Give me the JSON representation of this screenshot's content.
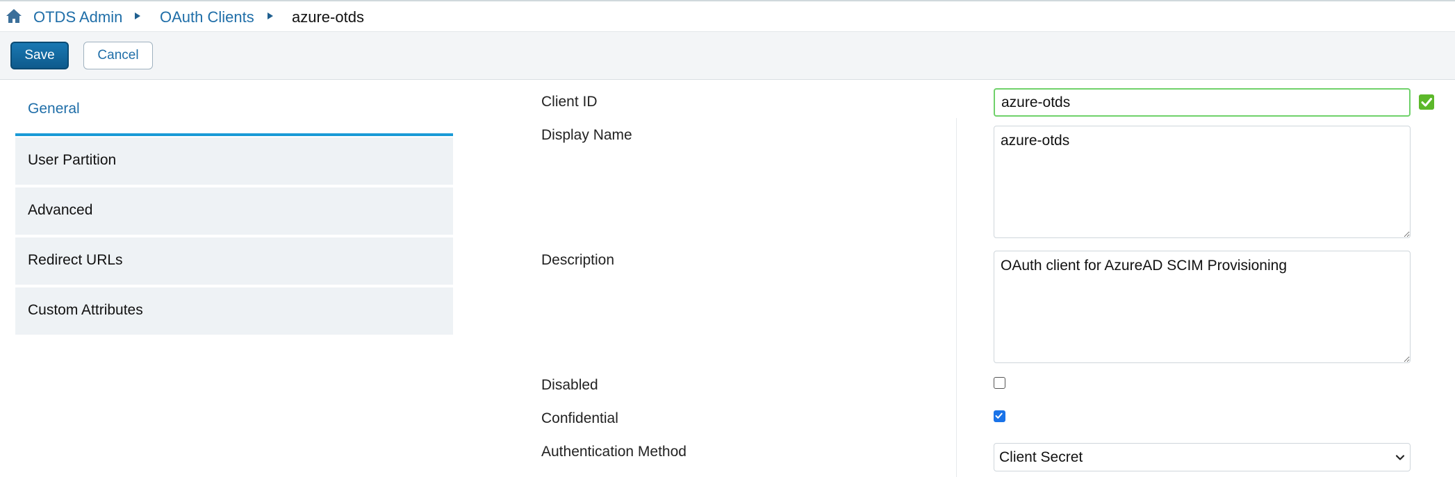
{
  "breadcrumb": {
    "items": [
      "OTDS Admin",
      "OAuth Clients"
    ],
    "current": "azure-otds"
  },
  "toolbar": {
    "save_label": "Save",
    "cancel_label": "Cancel"
  },
  "tabs": [
    {
      "label": "General",
      "active": true
    },
    {
      "label": "User Partition",
      "active": false
    },
    {
      "label": "Advanced",
      "active": false
    },
    {
      "label": "Redirect URLs",
      "active": false
    },
    {
      "label": "Custom Attributes",
      "active": false
    }
  ],
  "form": {
    "client_id": {
      "label": "Client ID",
      "value": "azure-otds",
      "valid": true
    },
    "display_name": {
      "label": "Display Name",
      "value": "azure-otds"
    },
    "description": {
      "label": "Description",
      "value": "OAuth client for AzureAD SCIM Provisioning"
    },
    "disabled": {
      "label": "Disabled",
      "checked": false
    },
    "confidential": {
      "label": "Confidential",
      "checked": true
    },
    "auth_method": {
      "label": "Authentication Method",
      "value": "Client Secret"
    }
  },
  "colors": {
    "accent": "#1f6ea8",
    "save_button": "#0e5a8c",
    "tab_underline": "#1a9ad6",
    "valid_green": "#5cb82a"
  }
}
